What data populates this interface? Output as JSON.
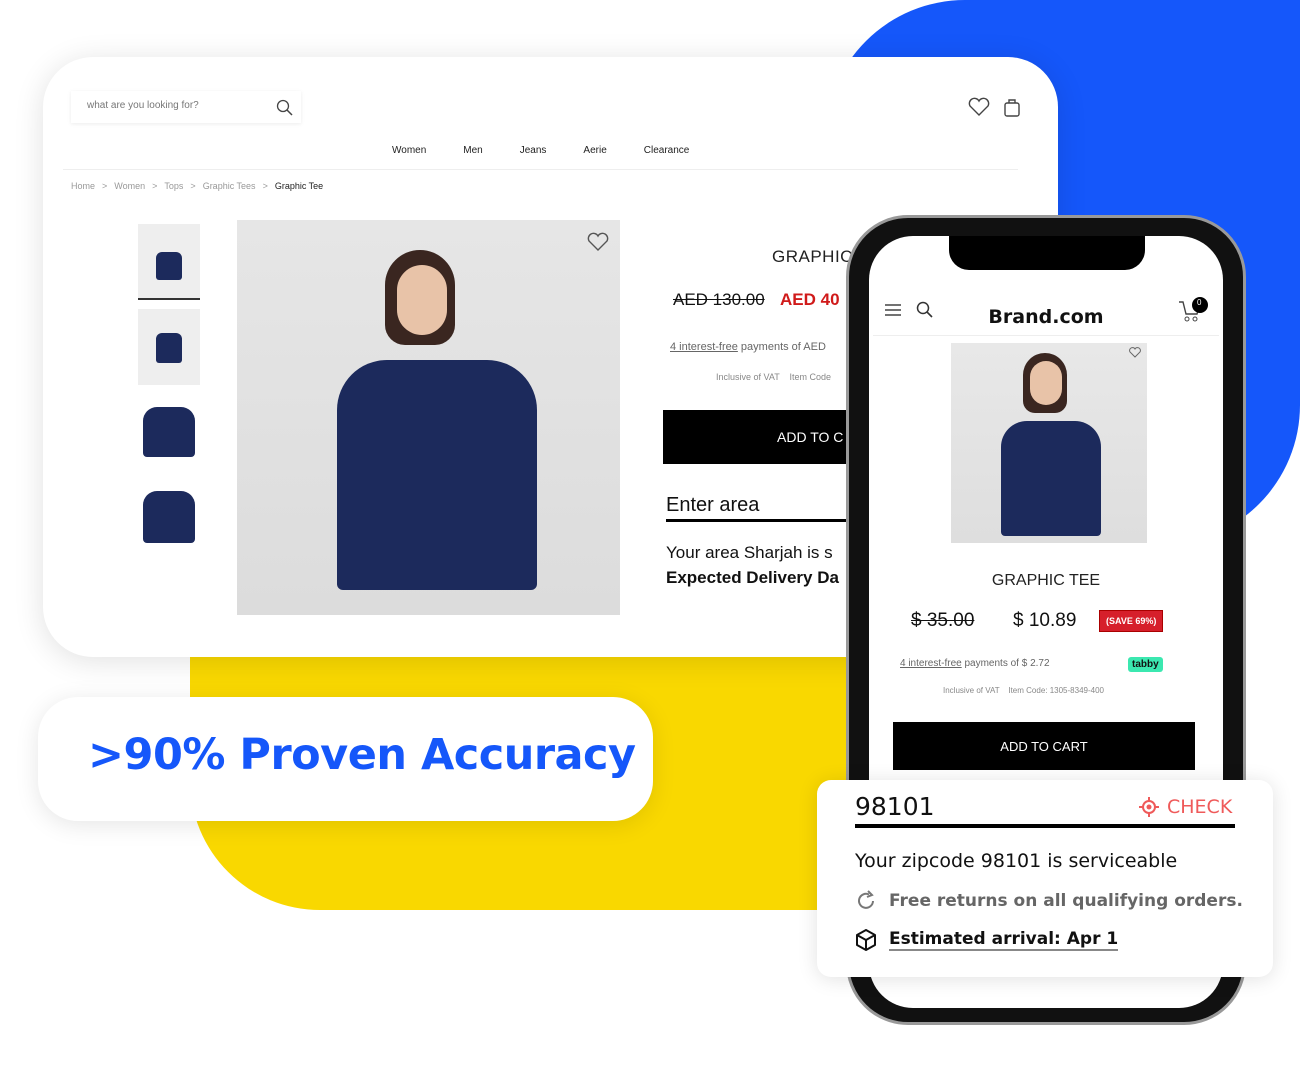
{
  "colors": {
    "blue": "#1557fa",
    "yellow": "#f9d800",
    "sale_red": "#d01a1a",
    "tabby": "#3be8b0"
  },
  "desktop": {
    "search_placeholder": "what are you looking for?",
    "nav": [
      "Women",
      "Men",
      "Jeans",
      "Aerie",
      "Clearance"
    ],
    "breadcrumb": [
      "Home",
      ">",
      "Women",
      ">",
      "Tops",
      ">",
      "Graphic Tees",
      ">",
      "Graphic Tee"
    ],
    "product_title": "GRAPHIC",
    "old_price": "AED 130.00",
    "new_price": "AED 40",
    "installments_link": "4 interest-free",
    "installments_text": " payments of AED",
    "vat": "Inclusive of VAT    Item Code",
    "add_to_cart": "ADD TO C",
    "area_placeholder": "Enter area",
    "area_message": "Your area Sharjah is s",
    "delivery": "Expected Delivery Da"
  },
  "headline": ">90% Proven Accuracy",
  "mobile": {
    "brand": "Brand.com",
    "cart_count": "0",
    "product_title": "GRAPHIC TEE",
    "old_price": "$ 35.00",
    "new_price": "$ 10.89",
    "save_badge": "(SAVE 69%)",
    "installments_link": "4 interest-free",
    "installments_text": " payments of $ 2.72",
    "tabby": "tabby",
    "vat": "Inclusive of VAT    Item Code: 1305-8349-400",
    "add_to_cart": "ADD TO CART"
  },
  "zip": {
    "value": "98101",
    "check": "CHECK",
    "serviceable": "Your zipcode 98101 is serviceable",
    "returns": "Free returns on all qualifying orders.",
    "arrival": "Estimated arrival: Apr 1"
  }
}
